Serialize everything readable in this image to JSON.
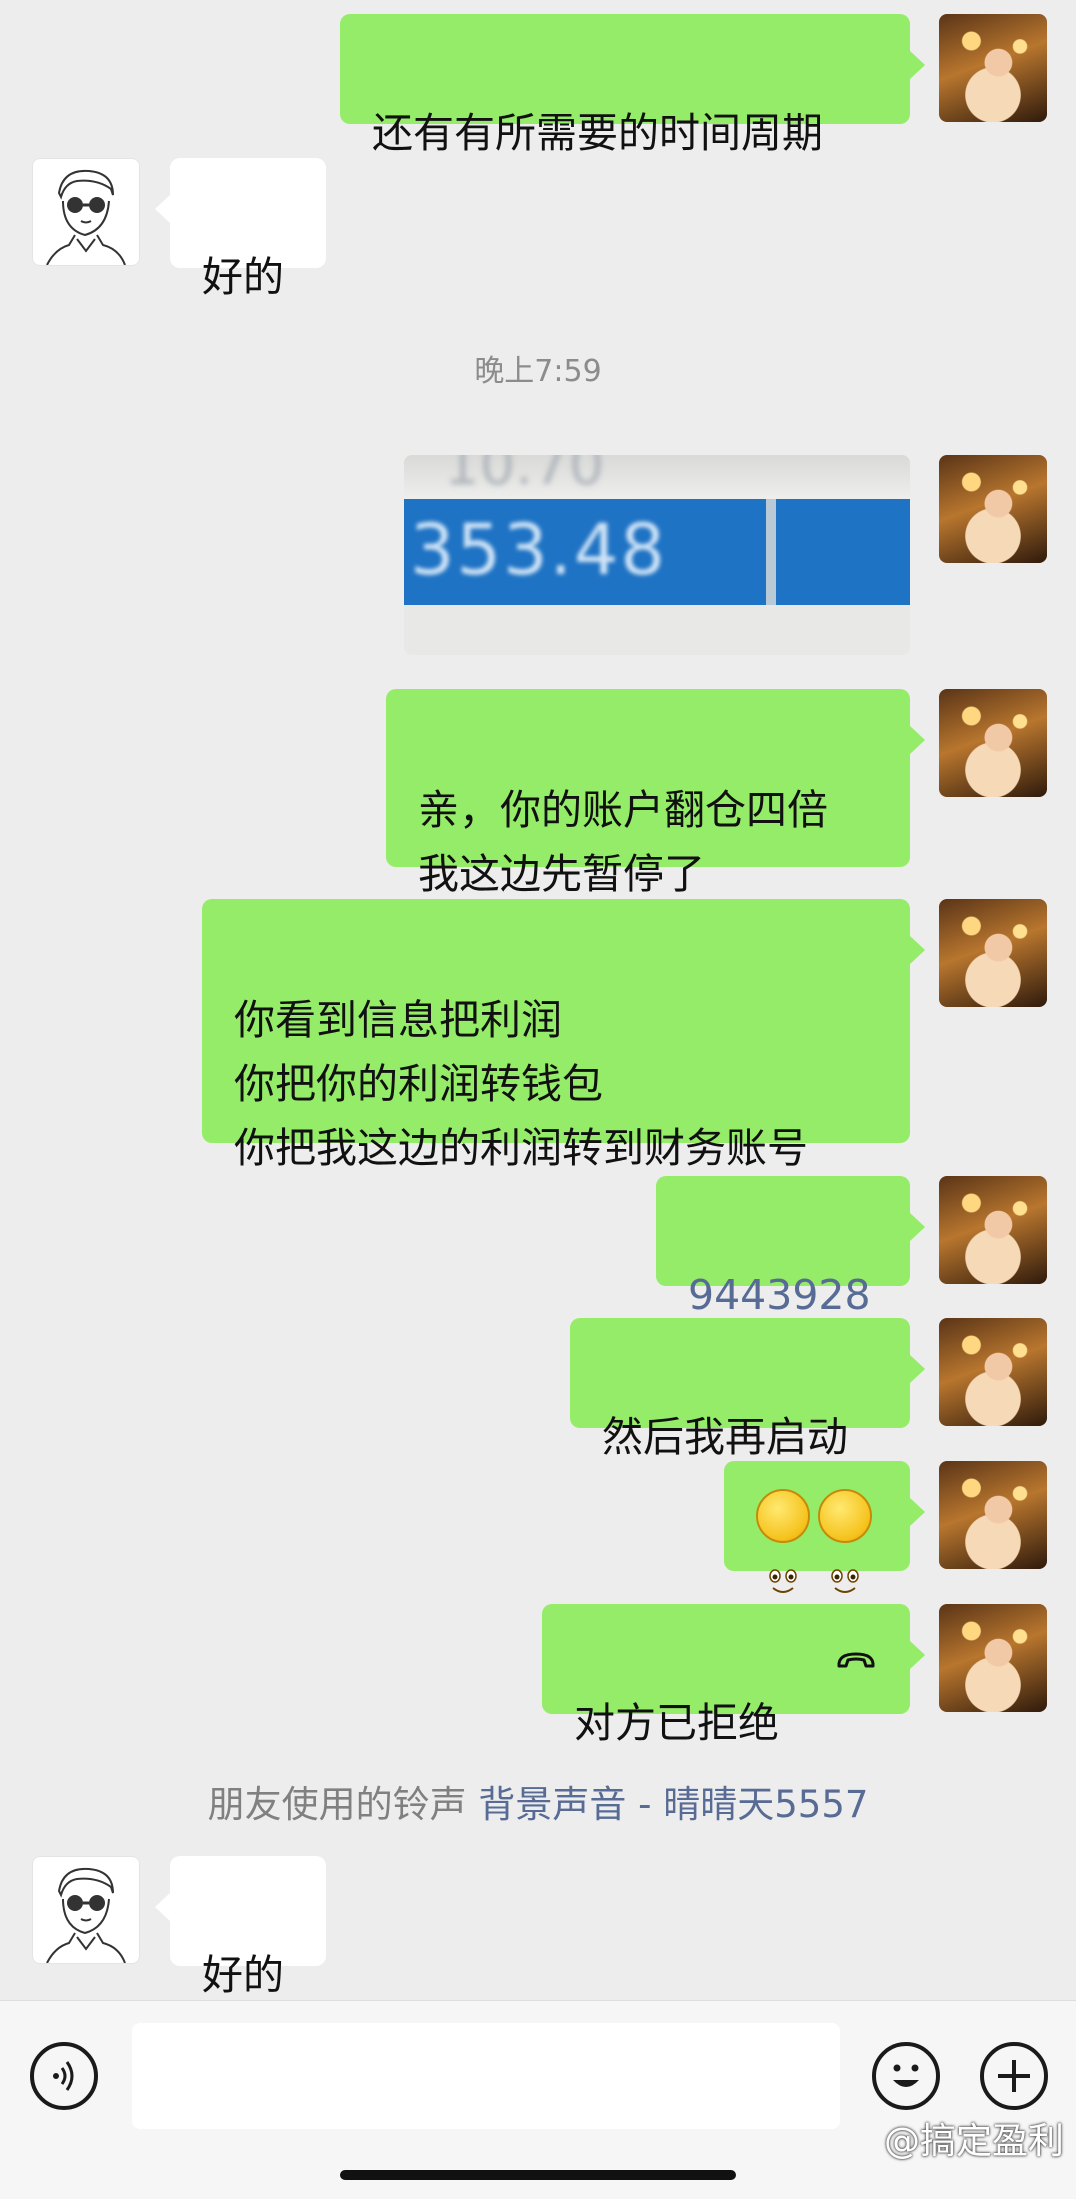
{
  "messages": [
    {
      "text": "还有有所需要的时间周期"
    },
    {
      "text": "好的"
    },
    {
      "text": "亲，你的账户翻仓四倍\n我这边先暂停了"
    },
    {
      "text": "你看到信息把利润\n你把你的利润转钱包\n你把我这边的利润转到财务账号"
    },
    {
      "text": "9443928"
    },
    {
      "text": "然后我再启动"
    },
    {
      "text": "对方已拒绝"
    },
    {
      "text": "好的"
    }
  ],
  "timestamp": "晚上7:59",
  "image_message": {
    "top_text": "10.70",
    "number_text": "353.48"
  },
  "notice": {
    "prefix": "朋友使用的铃声",
    "link": "背景声音 - 晴晴天5557"
  },
  "watermark": "@搞定盈利",
  "colors": {
    "me_bubble": "#95ec69",
    "them_bubble": "#ffffff",
    "background": "#ededed",
    "link": "#576b95",
    "number_link": "#576b95"
  }
}
